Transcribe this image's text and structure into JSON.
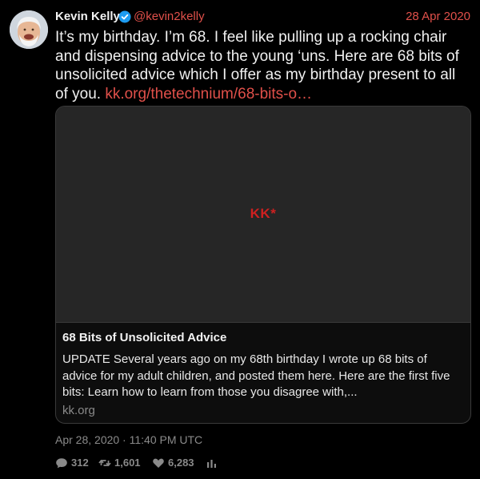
{
  "colors": {
    "background": "#000000",
    "accent_red": "#e0504a",
    "muted_gray": "#8a8a8a",
    "card_border": "#3a3a3a",
    "verified_blue": "#1d9bf0",
    "logo_red": "#cf2020"
  },
  "author": {
    "name": "Kevin Kelly",
    "handle": "@kevin2kelly",
    "verified": true,
    "avatar_icon": "profile-photo"
  },
  "tweet": {
    "date": "28 Apr 2020",
    "text": "It’s my birthday. I’m 68. I feel like pulling up a rocking chair and dispensing advice to the young ‘uns. Here are 68 bits of unsolicited advice which I offer as my birthday present to all of you.",
    "link_text": "kk.org/thetechnium/68-bits-o…"
  },
  "card": {
    "logo_text": "KK",
    "logo_glyph": "*",
    "title": "68 Bits of Unsolicited Advice",
    "description": "UPDATE Several years ago on my 68th birthday I wrote up 68 bits of advice for my adult children, and posted them here. Here are the first five bits: Learn how to learn from those you disagree with,...",
    "domain": "kk.org"
  },
  "footer": {
    "timestamp": "Apr 28, 2020 · 11:40 PM UTC",
    "stats": {
      "replies": "312",
      "retweets": "1,601",
      "likes": "6,283"
    },
    "icons": [
      "reply-icon",
      "retweet-icon",
      "like-icon",
      "analytics-icon"
    ]
  }
}
